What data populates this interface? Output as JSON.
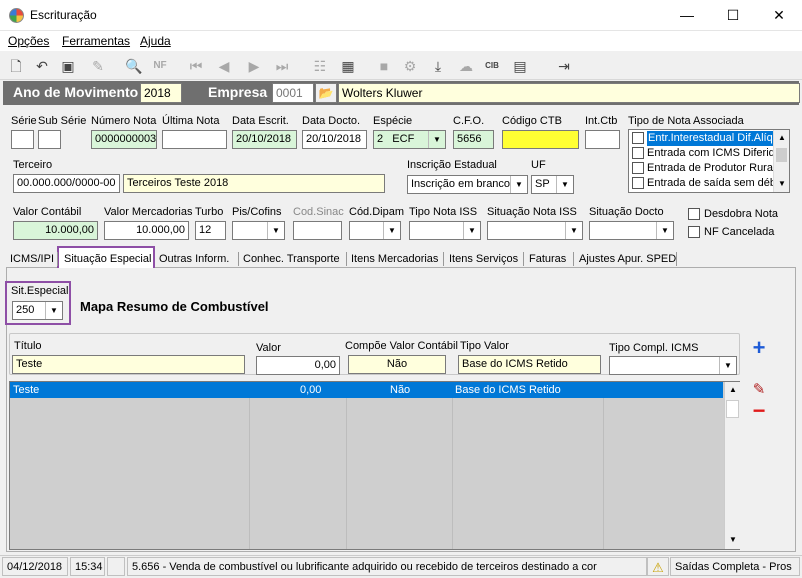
{
  "window": {
    "title": "Escrituração",
    "controls": {
      "minimize": "—",
      "maximize": "☐",
      "close": "✕"
    }
  },
  "menu": [
    "Opções",
    "Ferramentas",
    "Ajuda"
  ],
  "toolbar_icons": [
    "new-icon",
    "undo-icon",
    "save-icon",
    "delete-icon",
    "preview-icon",
    "nfe-icon",
    "first-icon",
    "prev-icon",
    "next-icon",
    "last-icon",
    "tree-icon",
    "calc-icon",
    "doc-icon",
    "tool-icon",
    "import-icon",
    "cloud-icon",
    "cib-icon",
    "server-icon",
    "exit-icon"
  ],
  "header": {
    "ano_label": "Ano de Movimento",
    "ano_value": "2018",
    "empresa_label": "Empresa",
    "empresa_code": "0001",
    "empresa_name": "Wolters Kluwer"
  },
  "labels": {
    "serie": "Série",
    "subserie": "Sub Série",
    "numero_nota": "Número Nota",
    "ultima_nota": "Última Nota",
    "data_escrit": "Data Escrit.",
    "data_docto": "Data Docto.",
    "especie": "Espécie",
    "cfo": "C.F.O.",
    "codigo_ctb": "Código CTB",
    "int_ctb": "Int.Ctb",
    "tipo_nota_assoc": "Tipo de Nota Associada",
    "terceiro": "Terceiro",
    "inscricao_estadual": "Inscrição Estadual",
    "uf": "UF",
    "valor_contabil": "Valor Contábil",
    "valor_mercadorias": "Valor Mercadorias",
    "turbo": "Turbo",
    "pis_cofins": "Pis/Cofins",
    "cod_sinac": "Cod.Sinac",
    "cod_dipam": "Cód.Dipam",
    "tipo_nota_iss": "Tipo Nota ISS",
    "situacao_nota_iss": "Situação Nota ISS",
    "situacao_docto": "Situação Docto",
    "desdobra_nota": "Desdobra Nota",
    "nf_cancelada": "NF Cancelada"
  },
  "values": {
    "numero_nota": "0000000003",
    "data_escrit": "20/10/2018",
    "data_docto": "20/10/2018",
    "especie_code": "2",
    "especie": "ECF",
    "cfo": "5656",
    "terceiro_cnpj": "00.000.000/0000-00",
    "terceiro_nome": "Terceiros Teste 2018",
    "inscricao_estadual": "Inscrição em branco",
    "uf": "SP",
    "valor_contabil": "10.000,00",
    "valor_mercadorias": "10.000,00",
    "turbo": "12"
  },
  "tipo_nota_options": [
    "Entr.Interestadual Dif.Alíq",
    "Entrada com ICMS Diferido",
    "Entrada de Produtor Rural",
    "Entrada de saída sem débi"
  ],
  "tabs": [
    "ICMS/IPI",
    "Situação Especial",
    "Outras Inform.",
    "Conhec. Transporte",
    "Itens Mercadorias",
    "Itens Serviços",
    "Faturas",
    "Ajustes Apur. SPED"
  ],
  "situacao_especial": {
    "sit_label": "Sit.Especial",
    "sit_value": "250",
    "title": "Mapa Resumo de Combustível",
    "form_labels": {
      "titulo": "Título",
      "valor": "Valor",
      "compoe": "Compõe Valor Contábil",
      "tipo_valor": "Tipo Valor",
      "tipo_compl": "Tipo Compl. ICMS"
    },
    "form_values": {
      "titulo": "Teste",
      "valor": "0,00",
      "compoe": "Não",
      "tipo_valor": "Base do ICMS Retido",
      "tipo_compl": ""
    },
    "rows": [
      {
        "titulo": "Teste",
        "valor": "0,00",
        "compoe": "Não",
        "tipo_valor": "Base do ICMS Retido"
      }
    ]
  },
  "status": {
    "date": "04/12/2018",
    "time": "15:34",
    "message": "5.656 - Venda de combustível ou lubrificante adquirido ou recebido de terceiros destinado a cor",
    "mode": "Saídas Completa - Pros"
  }
}
